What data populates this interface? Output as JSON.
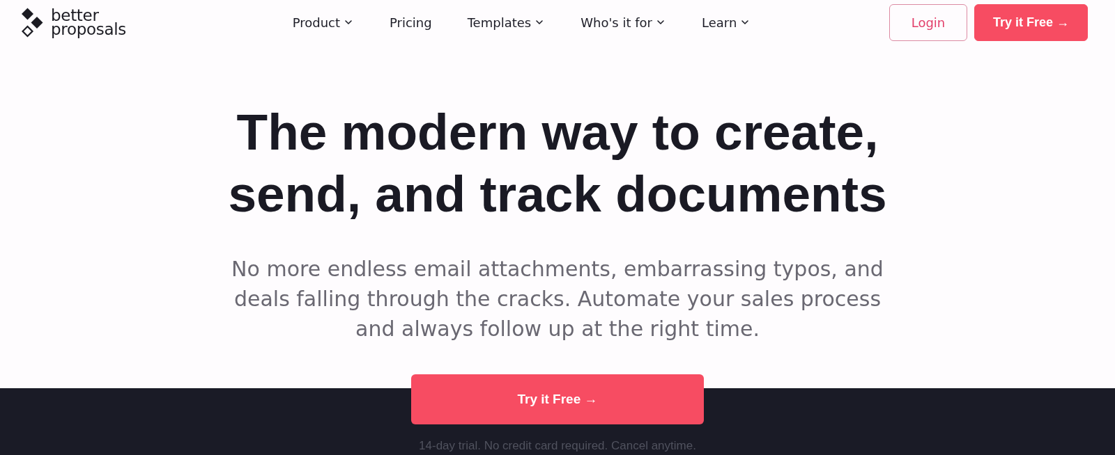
{
  "logo": {
    "text": "better proposals"
  },
  "nav": [
    {
      "label": "Product",
      "dropdown": true
    },
    {
      "label": "Pricing",
      "dropdown": false
    },
    {
      "label": "Templates",
      "dropdown": true
    },
    {
      "label": "Who's it for",
      "dropdown": true
    },
    {
      "label": "Learn",
      "dropdown": true
    }
  ],
  "header_buttons": [
    {
      "label": "Login",
      "kind": "outline"
    },
    {
      "label": "Try it Free →",
      "kind": "primary"
    }
  ],
  "hero": {
    "heading": "The modern way to create, send, and track documents",
    "subheading": "No more endless email attachments, embarrassing typos, and deals falling through the cracks. Automate your sales process and always follow up at the right time.",
    "cta": {
      "label": "Try it Free →"
    },
    "note": "14-day trial. No credit card required. Cancel anytime."
  }
}
